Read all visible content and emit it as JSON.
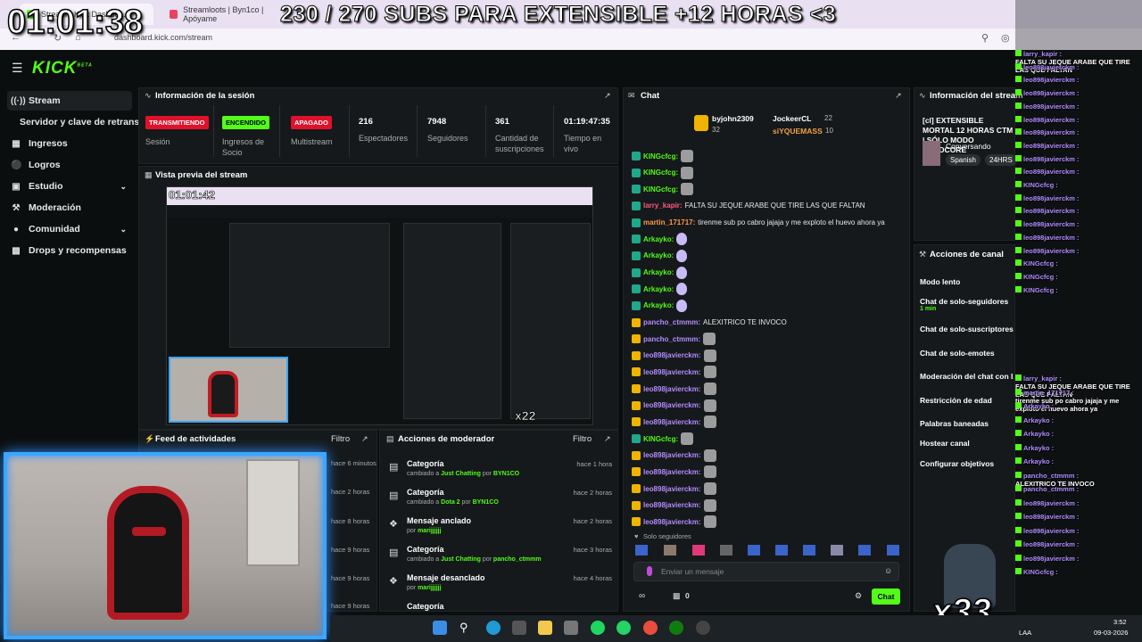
{
  "overlay": {
    "clock": "01:01:38",
    "title_banner": "230 / 270 SUBS PARA EXTENSIBLE +12 HORAS <3",
    "counter": "x33",
    "sub_counter": "x22"
  },
  "browser": {
    "tabs": [
      {
        "label": "Stream - Kick Dashbo..."
      },
      {
        "label": "Streamloots | Byn1co | Apóyame"
      }
    ],
    "url": "dashboard.kick.com/stream"
  },
  "app": {
    "logo": "KICK",
    "logo_sup": "BETA"
  },
  "sidebar": {
    "items": [
      {
        "label": "Stream",
        "icon": "broadcast-icon"
      },
      {
        "label": "Servidor y clave de retransmisión",
        "icon": ""
      },
      {
        "label": "Ingresos",
        "icon": "grid-icon"
      },
      {
        "label": "Logros",
        "icon": "trophy-icon"
      },
      {
        "label": "Estudio",
        "icon": "studio-icon"
      },
      {
        "label": "Moderación",
        "icon": "wrench-icon"
      },
      {
        "label": "Comunidad",
        "icon": "users-icon"
      },
      {
        "label": "Drops y recompensas",
        "icon": "gift-icon"
      }
    ]
  },
  "session": {
    "title": "Información de la sesión",
    "stats": [
      {
        "badge": "TRANSMITIENDO",
        "label": "Sesión"
      },
      {
        "badge": "ENCENDIDO",
        "label": "Ingresos de Socio"
      },
      {
        "badge": "APAGADO",
        "label": "Multistream"
      },
      {
        "value": "216",
        "label": "Espectadores"
      },
      {
        "value": "7948",
        "label": "Seguidores"
      },
      {
        "value": "361",
        "label": "Cantidad de suscripciones"
      },
      {
        "value": "01:19:47:35",
        "label": "Tiempo en vivo"
      }
    ]
  },
  "preview": {
    "title": "Vista previa del stream",
    "inner_clock": "01:01:42"
  },
  "feed": {
    "title": "Feed de actividades",
    "filter": "Filtro",
    "times": [
      "hace 6 minutos",
      "hace 2 horas",
      "hace 8 horas",
      "hace 9 horas",
      "hace 9 horas",
      "hace 9 horas"
    ]
  },
  "mod_actions": {
    "title": "Acciones de moderador",
    "filter": "Filtro",
    "rows": [
      {
        "title": "Categoría",
        "pre": "cambiado a",
        "target": "Just Chatting",
        "by": "por",
        "user": "BYN1CO",
        "time": "hace 1 hora"
      },
      {
        "title": "Categoría",
        "pre": "cambiado a",
        "target": "Dota 2",
        "by": "por",
        "user": "BYN1CO",
        "time": "hace 2 horas"
      },
      {
        "title": "Mensaje anclado",
        "pre": "por",
        "target": "",
        "by": "",
        "user": "marijjjjjj",
        "time": "hace 2 horas"
      },
      {
        "title": "Categoría",
        "pre": "cambiado a",
        "target": "Just Chatting",
        "by": "por",
        "user": "pancho_ctmmm",
        "time": "hace 3 horas"
      },
      {
        "title": "Mensaje desanclado",
        "pre": "por",
        "target": "",
        "by": "",
        "user": "marijjjjjj",
        "time": "hace 4 horas"
      },
      {
        "title": "Categoría",
        "pre": "",
        "target": "",
        "by": "",
        "user": "",
        "time": ""
      }
    ]
  },
  "chat": {
    "title": "Chat",
    "top_gifters": [
      {
        "name": "byjohn2309",
        "count": "32"
      },
      {
        "name": "JockeerCL",
        "count": "22"
      },
      {
        "name": "siYQUEMASS",
        "count": "10"
      }
    ],
    "messages": [
      {
        "user": "KINGcfcg:",
        "text": "",
        "color": "#53fc18",
        "emote": "gray"
      },
      {
        "user": "KINGcfcg:",
        "text": "",
        "color": "#53fc18",
        "emote": "gray"
      },
      {
        "user": "KINGcfcg:",
        "text": "",
        "color": "#53fc18",
        "emote": "gray"
      },
      {
        "user": "larry_kapir:",
        "text": "FALTA SU JEQUE ARABE QUE TIRE LAS QUE FALTAN",
        "color": "#ff5a7a",
        "emote": ""
      },
      {
        "user": "martin_171717:",
        "text": "tirenme sub po cabro jajaja y me exploto el huevo ahora ya",
        "color": "#ff9a4a",
        "emote": ""
      },
      {
        "user": "Arkayko:",
        "text": "",
        "color": "#53fc18",
        "emote": "drop"
      },
      {
        "user": "Arkayko:",
        "text": "",
        "color": "#53fc18",
        "emote": "drop"
      },
      {
        "user": "Arkayko:",
        "text": "",
        "color": "#53fc18",
        "emote": "drop"
      },
      {
        "user": "Arkayko:",
        "text": "",
        "color": "#53fc18",
        "emote": "drop"
      },
      {
        "user": "Arkayko:",
        "text": "",
        "color": "#53fc18",
        "emote": "drop"
      },
      {
        "user": "pancho_ctmmm:",
        "text": "ALEXITRICO TE INVOCO",
        "color": "#b48cff",
        "emote": ""
      },
      {
        "user": "pancho_ctmmm:",
        "text": "",
        "color": "#b48cff",
        "emote": "gray"
      },
      {
        "user": "leo898javierckm:",
        "text": "",
        "color": "#b48cff",
        "emote": "gray"
      },
      {
        "user": "leo898javierckm:",
        "text": "",
        "color": "#b48cff",
        "emote": "gray"
      },
      {
        "user": "leo898javierckm:",
        "text": "",
        "color": "#b48cff",
        "emote": "gray"
      },
      {
        "user": "leo898javierckm:",
        "text": "",
        "color": "#b48cff",
        "emote": "gray"
      },
      {
        "user": "leo898javierckm:",
        "text": "",
        "color": "#b48cff",
        "emote": "gray"
      },
      {
        "user": "KINGcfcg:",
        "text": "",
        "color": "#53fc18",
        "emote": "gray"
      },
      {
        "user": "leo898javierckm:",
        "text": "",
        "color": "#b48cff",
        "emote": "gray"
      },
      {
        "user": "leo898javierckm:",
        "text": "",
        "color": "#b48cff",
        "emote": "gray"
      },
      {
        "user": "leo898javierckm:",
        "text": "",
        "color": "#b48cff",
        "emote": "gray"
      },
      {
        "user": "leo898javierckm:",
        "text": "",
        "color": "#b48cff",
        "emote": "gray"
      },
      {
        "user": "leo898javierckm:",
        "text": "",
        "color": "#b48cff",
        "emote": "gray"
      }
    ],
    "followers_only_label": "Solo seguidores",
    "input_placeholder": "Enviar un mensaje",
    "points": "0",
    "send_label": "Chat"
  },
  "session_info_right": {
    "title": "Información del stream",
    "stream_title": "[cl] EXTENSIBLE MORTAL 12 HORAS CTM | SÓLO MODO HARDCORE",
    "category": "Conversando",
    "tags": [
      "Spanish",
      "24HRS"
    ]
  },
  "channel_actions": {
    "title": "Acciones de canal",
    "items": [
      {
        "label": "Modo lento",
        "sub": ""
      },
      {
        "label": "Chat de solo-seguidores",
        "sub": "1 min"
      },
      {
        "label": "Chat de solo-suscriptores",
        "sub": ""
      },
      {
        "label": "Chat de solo-emotes",
        "sub": ""
      },
      {
        "label": "Moderación del chat con IA",
        "sub": ""
      },
      {
        "label": "Restricción de edad",
        "sub": ""
      },
      {
        "label": "Palabras baneadas",
        "sub": ""
      },
      {
        "label": "Hostear canal",
        "sub": ""
      },
      {
        "label": "Configurar objetivos",
        "sub": ""
      }
    ]
  },
  "overlay_chat": [
    {
      "user": "larry_kapir :",
      "text": "FALTA SU JEQUE ARABE QUE TIRE LAS QUE FALTAN"
    },
    {
      "user": "leo898javierckm :",
      "text": ""
    },
    {
      "user": "leo898javierckm :",
      "text": ""
    },
    {
      "user": "leo898javierckm :",
      "text": ""
    },
    {
      "user": "leo898javierckm :",
      "text": ""
    },
    {
      "user": "leo898javierckm :",
      "text": ""
    },
    {
      "user": "leo898javierckm :",
      "text": ""
    },
    {
      "user": "leo898javierckm :",
      "text": ""
    },
    {
      "user": "leo898javierckm :",
      "text": ""
    },
    {
      "user": "leo898javierckm :",
      "text": ""
    },
    {
      "user": "KINGcfcg :",
      "text": ""
    },
    {
      "user": "leo898javierckm :",
      "text": ""
    },
    {
      "user": "leo898javierckm :",
      "text": ""
    },
    {
      "user": "leo898javierckm :",
      "text": ""
    },
    {
      "user": "leo898javierckm :",
      "text": ""
    },
    {
      "user": "leo898javierckm :",
      "text": ""
    },
    {
      "user": "KINGcfcg :",
      "text": ""
    },
    {
      "user": "KINGcfcg :",
      "text": ""
    },
    {
      "user": "KINGcfcg :",
      "text": ""
    }
  ],
  "overlay_chat2": [
    {
      "user": "larry_kapir :",
      "text": "FALTA SU JEQUE ARABE QUE TIRE LAS QUE FALTAN"
    },
    {
      "user": "martin_171717 :",
      "text": "tirenme sub po cabro jajaja y me exploto el huevo ahora ya"
    },
    {
      "user": "Arkayko :",
      "text": ""
    },
    {
      "user": "Arkayko :",
      "text": ""
    },
    {
      "user": "Arkayko :",
      "text": ""
    },
    {
      "user": "Arkayko :",
      "text": ""
    },
    {
      "user": "Arkayko :",
      "text": ""
    },
    {
      "user": "pancho_ctmmm :",
      "text": "ALEXITRICO TE INVOCO"
    },
    {
      "user": "pancho_ctmmm :",
      "text": ""
    },
    {
      "user": "leo898javierckm :",
      "text": ""
    },
    {
      "user": "leo898javierckm :",
      "text": ""
    },
    {
      "user": "leo898javierckm :",
      "text": ""
    },
    {
      "user": "leo898javierckm :",
      "text": ""
    },
    {
      "user": "leo898javierckm :",
      "text": ""
    },
    {
      "user": "KINGcfcg :",
      "text": ""
    }
  ],
  "taskbar": {
    "tray_lang": "LAA",
    "time": "3:52",
    "date": "09-03-2026"
  },
  "colors": {
    "accent": "#53fc18",
    "live_red": "#e0112b",
    "panel": "#15191b",
    "webcam_border": "#39a7ff"
  }
}
